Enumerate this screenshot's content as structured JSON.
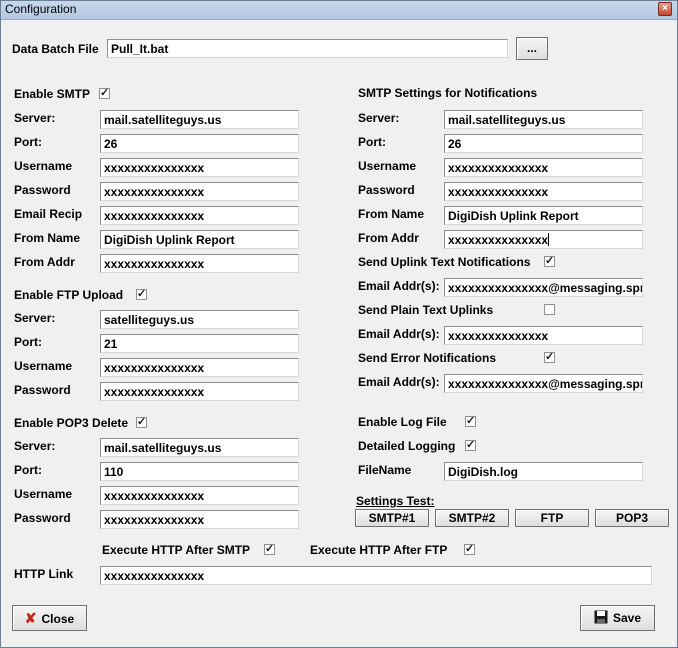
{
  "window": {
    "title": "Configuration",
    "close_glyph": "×"
  },
  "batch": {
    "label": "Data Batch File",
    "value": "Pull_It.bat",
    "browse_label": "..."
  },
  "smtp": {
    "enable_label": "Enable SMTP",
    "enabled": true,
    "fields": [
      {
        "label": "Server:",
        "value": "mail.satelliteguys.us"
      },
      {
        "label": "Port:",
        "value": "26"
      },
      {
        "label": "Username",
        "value": "xxxxxxxxxxxxxxx"
      },
      {
        "label": "Password",
        "value": "xxxxxxxxxxxxxxx"
      },
      {
        "label": "Email Recip",
        "value": "xxxxxxxxxxxxxxx"
      },
      {
        "label": "From Name",
        "value": "DigiDish Uplink Report"
      },
      {
        "label": "From Addr",
        "value": "xxxxxxxxxxxxxxx"
      }
    ]
  },
  "ftp": {
    "enable_label": "Enable FTP Upload",
    "enabled": true,
    "fields": [
      {
        "label": "Server:",
        "value": "satelliteguys.us"
      },
      {
        "label": "Port:",
        "value": "21"
      },
      {
        "label": "Username",
        "value": "xxxxxxxxxxxxxxx"
      },
      {
        "label": "Password",
        "value": "xxxxxxxxxxxxxxx"
      }
    ]
  },
  "pop3": {
    "enable_label": "Enable POP3 Delete",
    "enabled": true,
    "fields": [
      {
        "label": "Server:",
        "value": "mail.satelliteguys.us"
      },
      {
        "label": "Port:",
        "value": "110"
      },
      {
        "label": "Username",
        "value": "xxxxxxxxxxxxxxx"
      },
      {
        "label": "Password",
        "value": "xxxxxxxxxxxxxxx"
      }
    ]
  },
  "notify": {
    "heading": "SMTP Settings for Notifications",
    "fields": [
      {
        "label": "Server:",
        "value": "mail.satelliteguys.us"
      },
      {
        "label": "Port:",
        "value": "26"
      },
      {
        "label": "Username",
        "value": "xxxxxxxxxxxxxxx"
      },
      {
        "label": "Password",
        "value": "xxxxxxxxxxxxxxx"
      },
      {
        "label": "From Name",
        "value": "DigiDish Uplink Report"
      },
      {
        "label": "From Addr",
        "value": "xxxxxxxxxxxxxxx"
      }
    ],
    "uplink_text": {
      "label": "Send Uplink Text Notifications",
      "enabled": true,
      "addr_label": "Email Addr(s):",
      "addr_value": "xxxxxxxxxxxxxxx@messaging.sprintpcs.com"
    },
    "plain_text": {
      "label": "Send Plain Text Uplinks",
      "enabled": false,
      "addr_label": "Email Addr(s):",
      "addr_value": "xxxxxxxxxxxxxxx"
    },
    "error": {
      "label": "Send Error Notifications",
      "enabled": true,
      "addr_label": "Email Addr(s):",
      "addr_value": "xxxxxxxxxxxxxxx@messaging.sprintpcs.com"
    }
  },
  "logging": {
    "enable_label": "Enable Log File",
    "enabled": true,
    "detailed_label": "Detailed Logging",
    "detailed": true,
    "filename_label": "FileName",
    "filename_value": "DigiDish.log"
  },
  "test": {
    "label": "Settings Test:",
    "buttons": [
      "SMTP#1",
      "SMTP#2",
      "FTP",
      "POP3"
    ]
  },
  "http": {
    "after_smtp_label": "Execute HTTP After SMTP",
    "after_smtp": true,
    "after_ftp_label": "Execute HTTP After FTP",
    "after_ftp": true,
    "link_label": "HTTP Link",
    "link_value": "xxxxxxxxxxxxxxx"
  },
  "footer": {
    "close_label": "Close",
    "save_label": "Save"
  },
  "colors": {
    "close_icon": "#c0281c",
    "save_icon": "#1a1a1a"
  },
  "icons": {
    "close": "red-x-icon",
    "save": "floppy-disk-icon"
  }
}
